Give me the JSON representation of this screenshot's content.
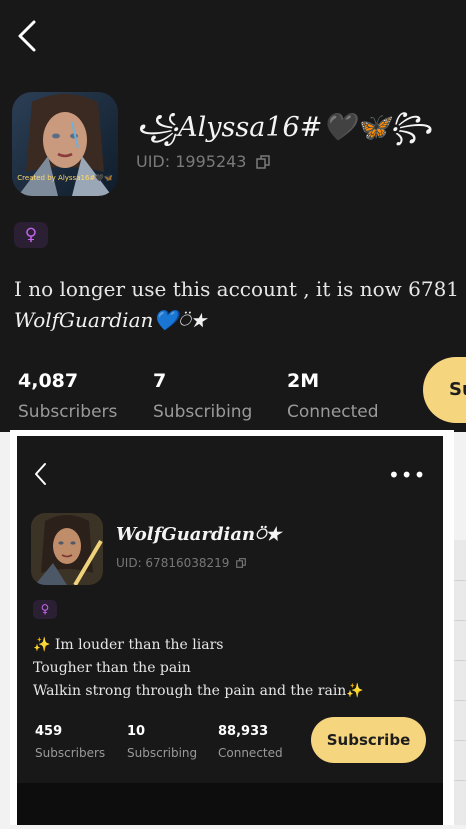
{
  "main": {
    "username": "꧁Alyssa16#🖤🦋꧂",
    "uid": "UID: 1995243",
    "gender_symbol": "♀",
    "bio_line1": "I no longer use this account , it is now 6781",
    "bio_line2": "WolfGuardian💙⍥★",
    "avatar_caption": "Created by Alyssa16#🖤🦋",
    "stats": [
      {
        "value": "4,087",
        "label": "Subscribers"
      },
      {
        "value": "7",
        "label": "Subscribing"
      },
      {
        "value": "2M",
        "label": "Connected"
      }
    ],
    "subscribe_label": "Su"
  },
  "inner": {
    "more_label": "•••",
    "username": "WolfGuardian⍥★",
    "uid": "UID: 67816038219",
    "gender_symbol": "♀",
    "bio": [
      "✨ Im louder than the liars",
      "Tougher than the pain",
      "Walkin strong through the pain and the rain✨"
    ],
    "stats": [
      {
        "value": "459",
        "label": "Subscribers"
      },
      {
        "value": "10",
        "label": "Subscribing"
      },
      {
        "value": "88,933",
        "label": "Connected"
      }
    ],
    "subscribe_label": "Subscribe"
  },
  "colors": {
    "background": "#181818",
    "accent": "#f6d57f",
    "gender_pink": "#c265e6"
  },
  "icons": [
    "back-arrow-icon",
    "copy-icon",
    "female-icon",
    "more-icon"
  ]
}
